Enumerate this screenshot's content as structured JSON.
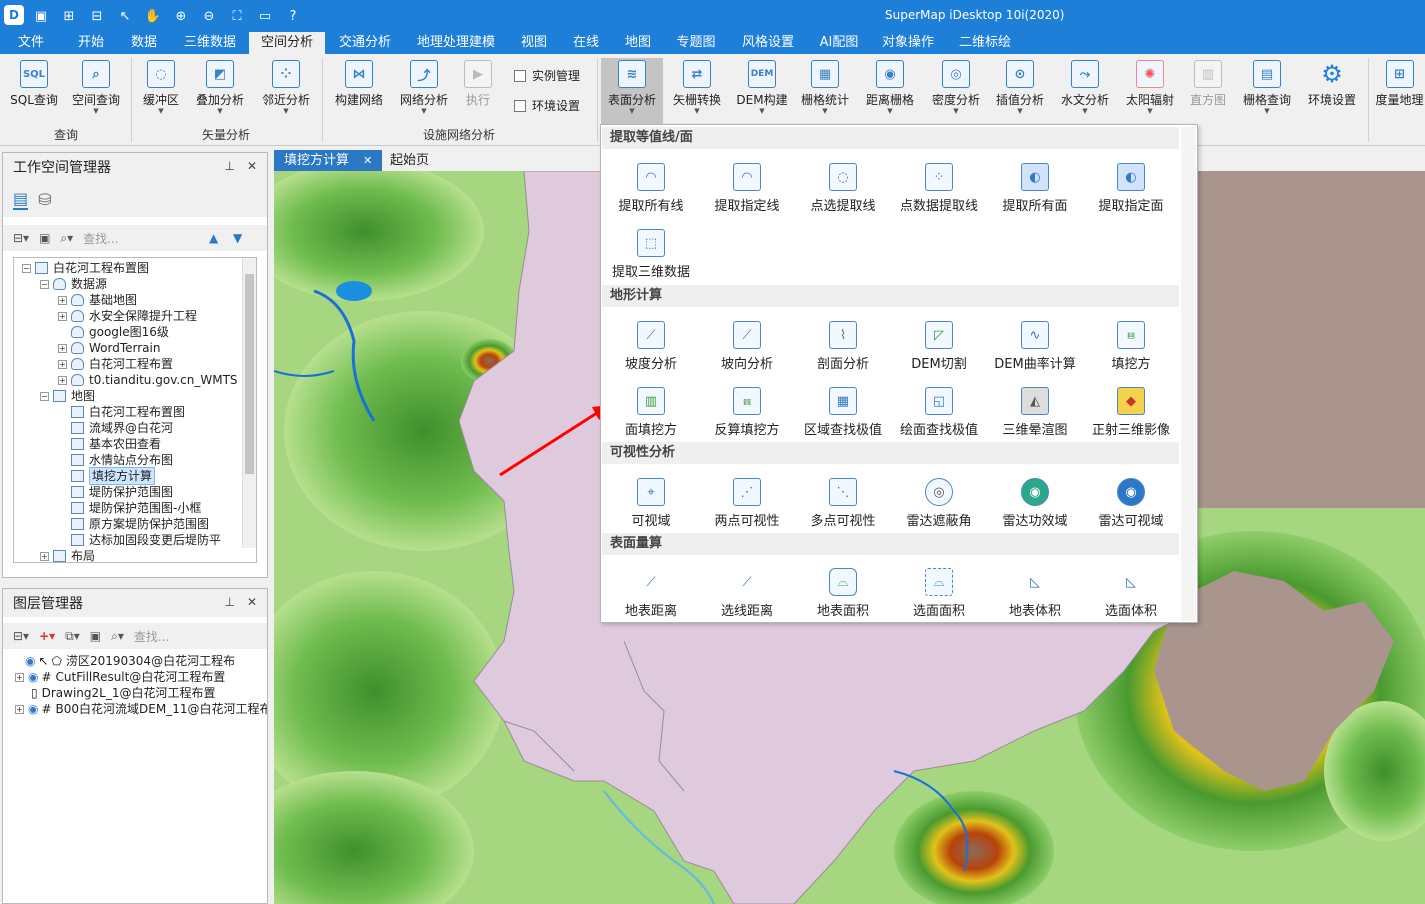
{
  "app": {
    "title": "SuperMap iDesktop 10i(2020)"
  },
  "qat": [
    {
      "icon": "save-icon",
      "glyph": "▣"
    },
    {
      "icon": "new-window-icon",
      "glyph": "⊞"
    },
    {
      "icon": "layout-icon",
      "glyph": "⊟"
    },
    {
      "icon": "pointer-icon",
      "glyph": "↖"
    },
    {
      "icon": "pan-hand-icon",
      "glyph": "✋"
    },
    {
      "icon": "zoom-in-icon",
      "glyph": "⊕"
    },
    {
      "icon": "zoom-out-icon",
      "glyph": "⊖"
    },
    {
      "icon": "full-extent-icon",
      "glyph": "⛶"
    },
    {
      "icon": "open-folder-icon",
      "glyph": "▭"
    },
    {
      "icon": "help-icon",
      "glyph": "?"
    }
  ],
  "menu": {
    "tabs": [
      "文件",
      "开始",
      "数据",
      "三维数据",
      "空间分析",
      "交通分析",
      "地理处理建模",
      "视图",
      "在线",
      "地图",
      "专题图",
      "风格设置",
      "AI配图",
      "对象操作",
      "二维标绘"
    ],
    "active": "空间分析"
  },
  "ribbon": {
    "groups": [
      "查询",
      "矢量分析",
      "设施网络分析"
    ],
    "buttons": [
      "SQL查询",
      "空间查询",
      "缓冲区",
      "叠加分析",
      "邻近分析",
      "构建网络",
      "网络分析",
      "执行",
      "表面分析",
      "矢栅转换",
      "DEM构建",
      "栅格统计",
      "距离栅格",
      "密度分析",
      "插值分析",
      "水文分析",
      "太阳辐射",
      "直方图",
      "栅格查询",
      "环境设置",
      "度量地理"
    ],
    "icon_glyphs": {
      "sql": "SQL",
      "dem": "DEM"
    },
    "checkboxes": [
      "实例管理",
      "环境设置"
    ]
  },
  "workspace": {
    "title": "工作空间管理器",
    "search_placeholder": "查找...",
    "tree": [
      "白花河工程布置图",
      "数据源",
      "基础地图",
      "水安全保障提升工程",
      "google图16级",
      "WordTerrain",
      "白花河工程布置",
      "t0.tianditu.gov.cn_WMTS",
      "地图",
      "白花河工程布置图",
      "流域界@白花河",
      "基本农田查看",
      "水情站点分布图",
      "填挖方计算",
      "堤防保护范围图",
      "堤防保护范围图-小框",
      "原方案堤防保护范围图",
      "达标加固段变更后堤防平",
      "布局"
    ],
    "selected": "填挖方计算"
  },
  "layers": {
    "title": "图层管理器",
    "search_placeholder": "查找...",
    "items": [
      "涝区20190304@白花河工程布",
      "CutFillResult@白花河工程布置",
      "Drawing2L_1@白花河工程布置",
      "B00白花河流域DEM_11@白花河工程布"
    ]
  },
  "doc_tabs": [
    "填挖方计算",
    "起始页"
  ],
  "dropdown": {
    "sections": [
      {
        "title": "提取等值线/面",
        "items": [
          "提取所有线",
          "提取指定线",
          "点选提取线",
          "点数据提取线",
          "提取所有面",
          "提取指定面",
          "提取三维数据"
        ]
      },
      {
        "title": "地形计算",
        "items": [
          "坡度分析",
          "坡向分析",
          "剖面分析",
          "DEM切割",
          "DEM曲率计算",
          "填挖方",
          "面填挖方",
          "反算填挖方",
          "区域查找极值",
          "绘面查找极值",
          "三维晕渲图",
          "正射三维影像"
        ]
      },
      {
        "title": "可视性分析",
        "items": [
          "可视域",
          "两点可视性",
          "多点可视性",
          "雷达遮蔽角",
          "雷达功效域",
          "雷达可视域"
        ]
      },
      {
        "title": "表面量算",
        "items": [
          "地表距离",
          "选线距离",
          "地表面积",
          "选面面积",
          "地表体积",
          "选面体积"
        ]
      }
    ]
  },
  "colors": {
    "accent": "#1e7fd8",
    "annotation_arrow": "#ff0000"
  }
}
